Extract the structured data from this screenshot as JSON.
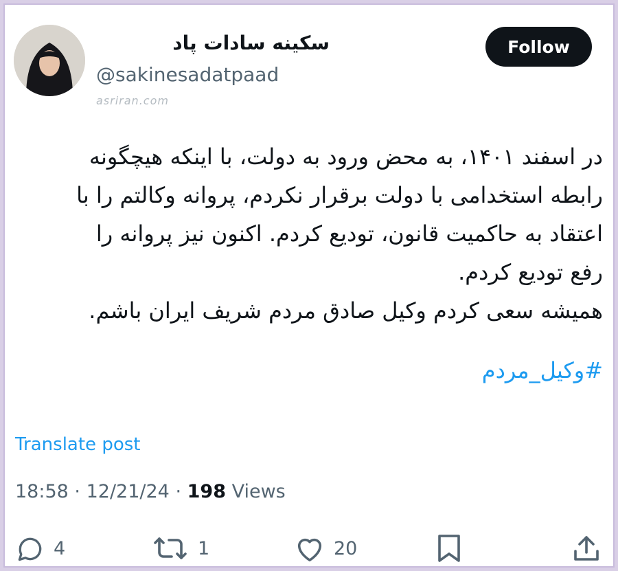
{
  "author": {
    "display_name": "سکینه سادات پاد",
    "handle": "@sakinesadatpaad"
  },
  "watermark": "asriran.com",
  "follow_label": "Follow",
  "post": {
    "lines": [
      "در اسفند ۱۴۰۱، به محض ورود به دولت، با اینکه هیچگونه",
      "رابطه استخدامی با دولت برقرار نکردم، پروانه وکالتم را با",
      "اعتقاد به حاکمیت قانون، تودیع کردم. اکنون نیز پروانه را",
      "رفع تودیع کردم.",
      "همیشه سعی کردم وکیل صادق مردم شریف ایران باشم."
    ],
    "hashtag": "#وکیل_مردم"
  },
  "translate_label": "Translate post",
  "meta": {
    "time": "18:58",
    "separator": "·",
    "date": "12/21/24",
    "views_count": "198",
    "views_label": "Views"
  },
  "actions": {
    "replies": "4",
    "reposts": "1",
    "likes": "20"
  },
  "icons": [
    "reply-icon",
    "repost-icon",
    "like-icon",
    "bookmark-icon",
    "share-icon"
  ],
  "colors": {
    "link": "#1d9bf0",
    "text": "#0f1419",
    "muted": "#536471",
    "button": "#0f1419"
  }
}
